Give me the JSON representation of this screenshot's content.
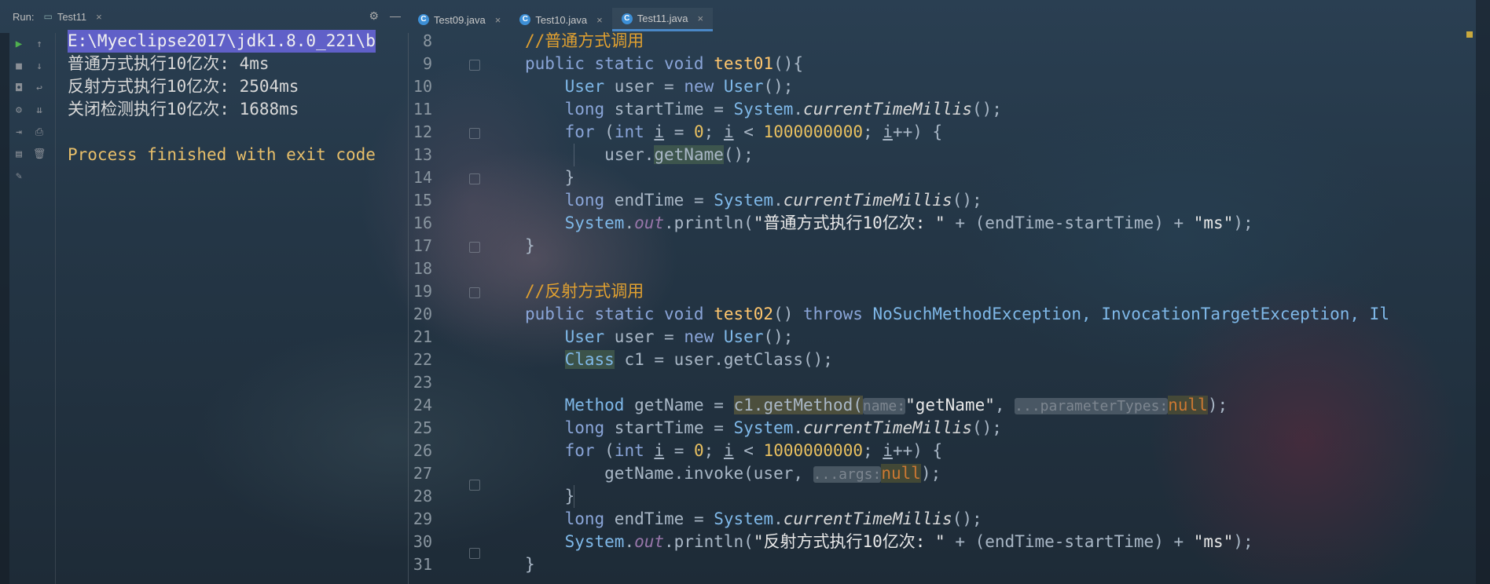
{
  "run_tool": {
    "label": "Run:",
    "tab_label": "Test11",
    "close_glyph": "×"
  },
  "editor_tabs": [
    {
      "label": "Test09.java"
    },
    {
      "label": "Test10.java"
    },
    {
      "label": "Test11.java",
      "active": true
    }
  ],
  "console": {
    "lines": [
      "E:\\Myeclipse2017\\jdk1.8.0_221\\b",
      "普通方式执行10亿次: 4ms",
      "反射方式执行10亿次: 2504ms",
      "关闭检测执行10亿次: 1688ms",
      "",
      "Process finished with exit code"
    ]
  },
  "editor": {
    "line_numbers": [
      "8",
      "9",
      "10",
      "11",
      "12",
      "13",
      "14",
      "15",
      "16",
      "17",
      "18",
      "19",
      "20",
      "21",
      "22",
      "23",
      "24",
      "25",
      "26",
      "27",
      "28",
      "29",
      "30",
      "31"
    ],
    "comment1": "//普通方式调用",
    "comment2": "//反射方式调用",
    "test01_name": "test01",
    "test02_name": "test02",
    "str_normal": "\"普通方式执行10亿次: \"",
    "str_reflect": "\"反射方式执行10亿次: \"",
    "str_ms": "\"ms\"",
    "str_getname": "\"getName\"",
    "hint_name": "name:",
    "hint_param": "...parameterTypes:",
    "hint_args": "...args:",
    "loop_count": "1000000000",
    "exceptions": "NoSuchMethodException, InvocationTargetException, Il"
  },
  "colors": {
    "keyword": "#cc7832",
    "comment": "#e0a030",
    "selection": "#6060c8",
    "tab_accent": "#4a88c7"
  },
  "icons": {
    "settings": "gear-icon",
    "minimize": "minus-icon",
    "run": "play-icon",
    "stop": "stop-icon"
  }
}
